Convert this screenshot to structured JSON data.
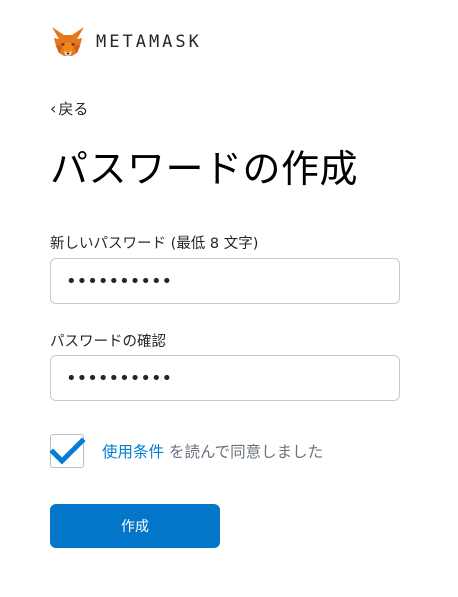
{
  "brand": {
    "name": "METAMASK",
    "logo_icon": "metamask-fox-icon"
  },
  "nav": {
    "back_label": "戻る",
    "back_icon": "chevron-left-icon"
  },
  "page": {
    "title": "パスワードの作成"
  },
  "form": {
    "new_password": {
      "label": "新しいパスワード (最低 8 文字)",
      "value": "••••••••••"
    },
    "confirm_password": {
      "label": "パスワードの確認",
      "value": "••••••••••"
    },
    "terms": {
      "checked": true,
      "link_text": "使用条件",
      "rest_text": " を読んで同意しました"
    },
    "submit_label": "作成"
  },
  "colors": {
    "accent": "#0376c9",
    "link": "#037dd6",
    "checkmark": "#037dd6"
  }
}
